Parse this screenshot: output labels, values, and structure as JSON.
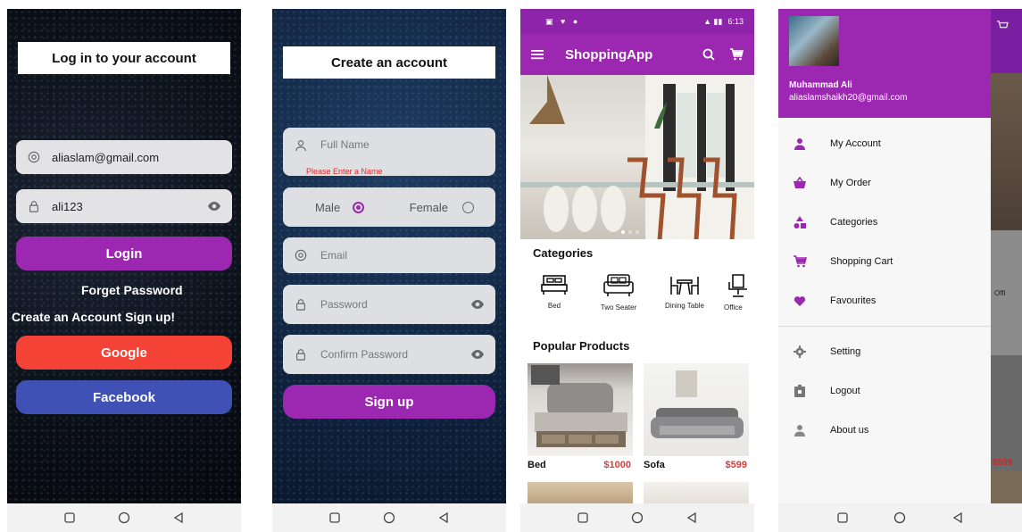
{
  "login": {
    "title": "Log in to your account",
    "email_value": "aliaslam@gmail.com",
    "password_value": "ali123",
    "login_label": "Login",
    "forget_label": "Forget Password",
    "create_label": "Create an Account  Sign up!",
    "google_label": "Google",
    "facebook_label": "Facebook"
  },
  "signup": {
    "title": "Create an account",
    "fullname_placeholder": "Full Name",
    "fullname_error": "Please Enter a Name",
    "male_label": "Male",
    "female_label": "Female",
    "email_placeholder": "Email",
    "password_placeholder": "Password",
    "confirm_placeholder": "Confirm Password",
    "signup_label": "Sign up"
  },
  "shop": {
    "status_time": "6:13",
    "app_title": "ShoppingApp",
    "categories_title": "Categories",
    "categories": [
      "Bed",
      "Two Seater",
      "Dining Table",
      "Office"
    ],
    "popular_title": "Popular Products",
    "products": [
      {
        "name": "Bed",
        "price": "$1000"
      },
      {
        "name": "Sofa",
        "price": "$599"
      }
    ]
  },
  "drawer": {
    "user_name": "Muhammad Ali",
    "user_email": "aliaslamshaikh20@gmail.com",
    "items": [
      "My Account",
      "My Order",
      "Categories",
      "Shopping Cart",
      "Favourites"
    ],
    "items2": [
      "Setting",
      "Logout",
      "About us"
    ],
    "behind_category": "Offi",
    "behind_price": "$599"
  },
  "colors": {
    "purple": "#9c27b0",
    "google": "#f44336",
    "facebook": "#3f51b5",
    "price_red": "#e53935"
  }
}
